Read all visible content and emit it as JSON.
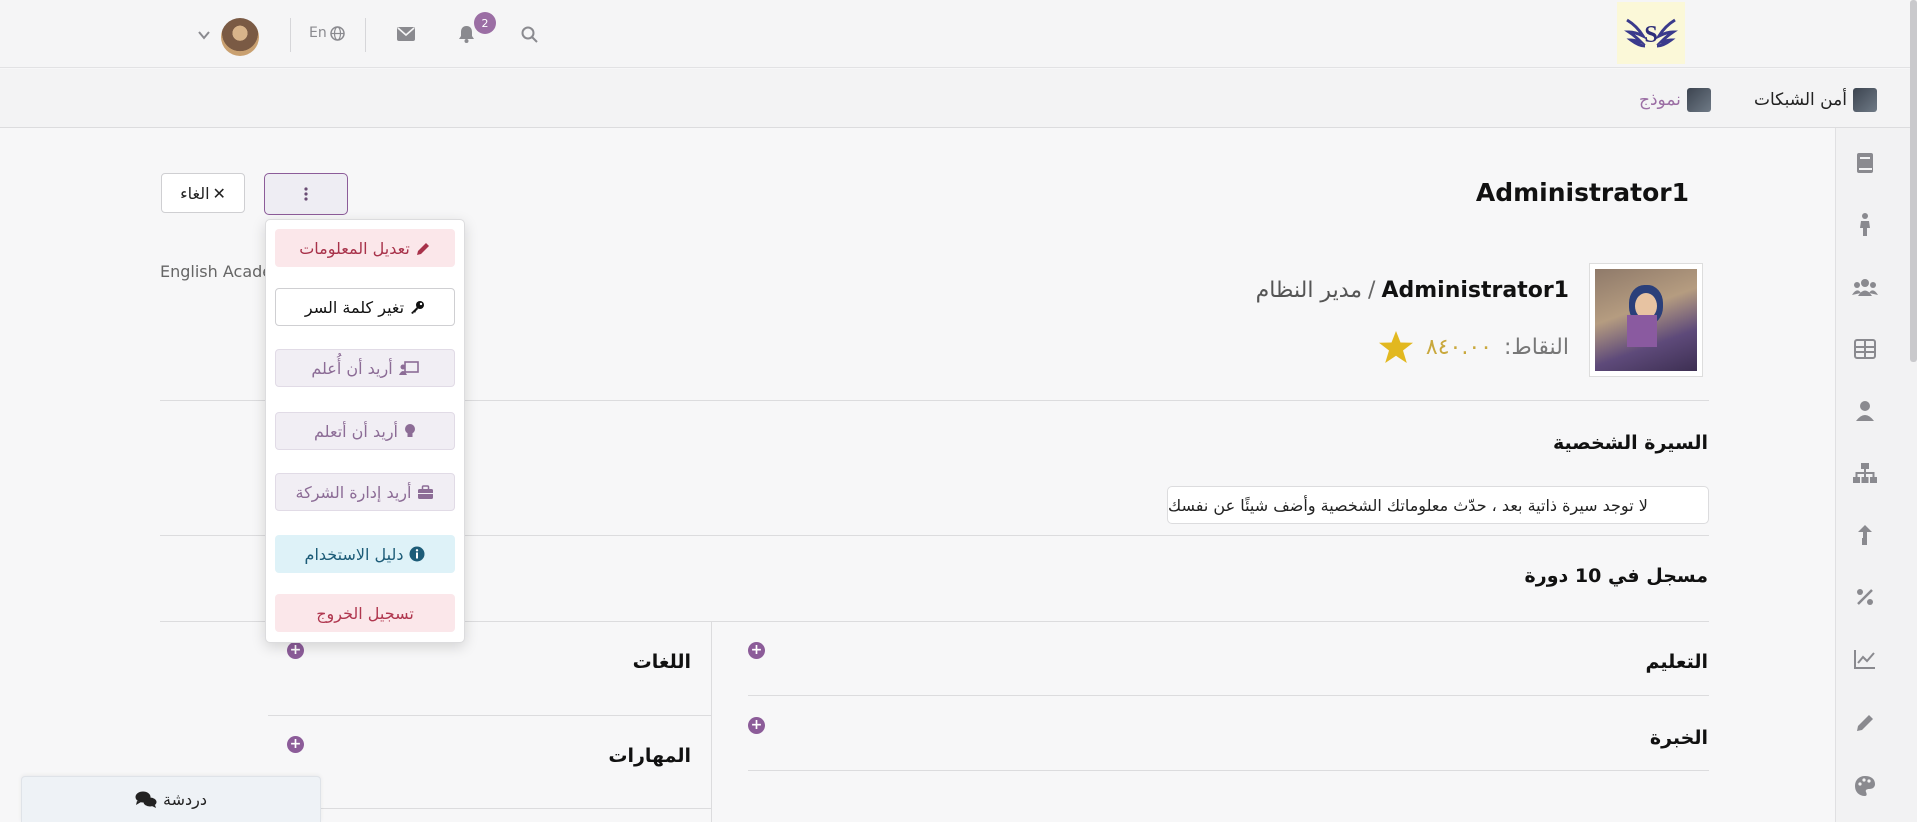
{
  "topbar": {
    "notification_count": "2",
    "language": "En"
  },
  "breadcrumb": {
    "course": "أمن الشبكات",
    "item": "نموذج"
  },
  "profile": {
    "title": "Administrator1",
    "name": "Administrator1",
    "separator": "/",
    "role": "مدير النظام",
    "points_label": "النقاط:",
    "points_value": "٨٤٠.٠٠",
    "affiliation": "English Acade"
  },
  "actions": {
    "cancel_label": "الغاء"
  },
  "menu": {
    "edit_info": "تعديل المعلومات",
    "change_password": "تغير كلمة السر",
    "want_teach": "أريد أن أُعلم",
    "want_learn": "أريد أن أتعلم",
    "manage_company": "أريد إدارة الشركة",
    "user_guide": "دليل الاستخدام",
    "logout": "تسجيل الخروج"
  },
  "sections": {
    "bio_title": "السيرة الشخصية",
    "bio_text": "لا توجد سيرة ذاتية بعد ، حدّث معلوماتك الشخصية وأضف شيئًا عن نفسك",
    "enrolled": "مسجل في 10 دورة",
    "education": "التعليم",
    "experience": "الخبرة",
    "languages": "اللغات",
    "skills": "المهارات"
  },
  "chat": {
    "label": "دردشة"
  },
  "colors": {
    "accent": "#8c5c99",
    "star": "#e2b820",
    "points": "#c9a83d"
  },
  "icons": {
    "sidebar": [
      "book-icon",
      "person-walking-icon",
      "users-icon",
      "table-icon",
      "user-icon",
      "sitemap-icon",
      "share-icon",
      "percent-icon",
      "chart-line-icon",
      "pencil-icon",
      "palette-icon"
    ]
  }
}
